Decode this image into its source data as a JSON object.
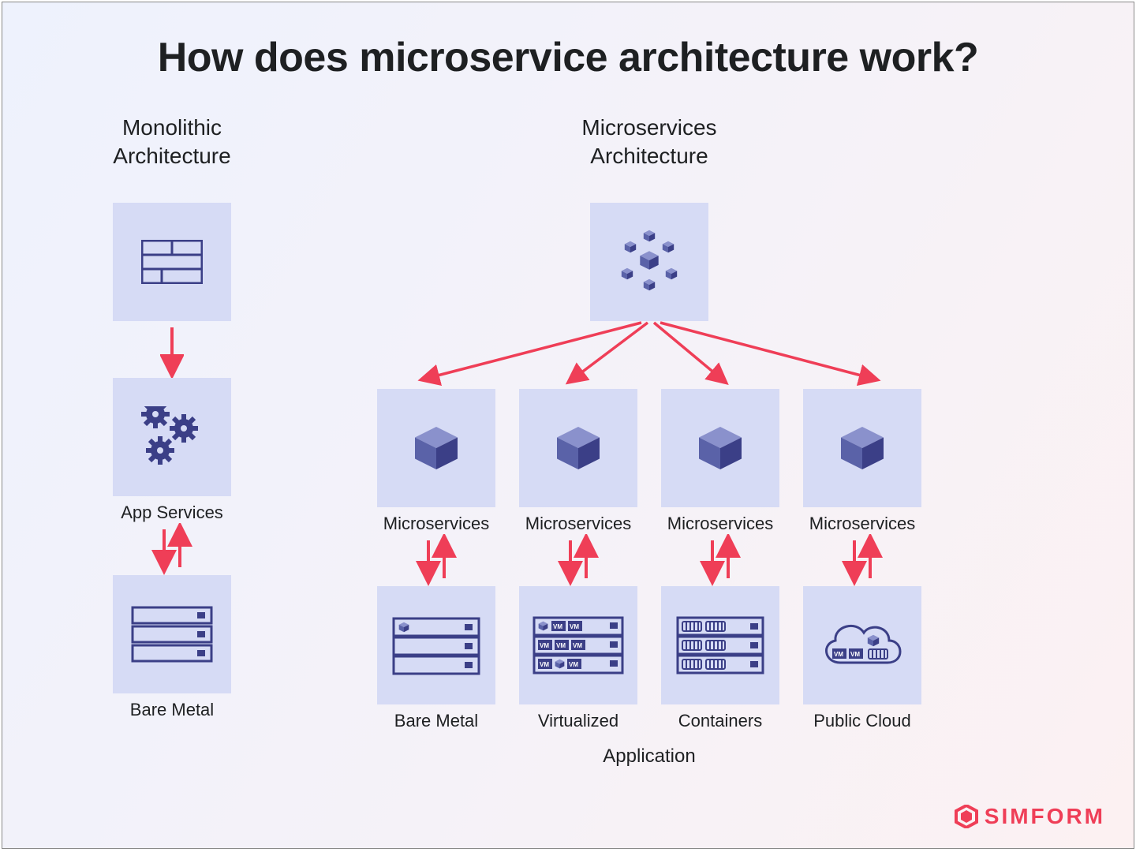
{
  "title": "How does microservice architecture work?",
  "monolithic": {
    "title": "Monolithic\nArchitecture",
    "app_services_label": "App Services",
    "bare_metal_label": "Bare Metal"
  },
  "microservices": {
    "title": "Microservices\nArchitecture",
    "node_label": "Microservices",
    "targets": [
      {
        "label": "Bare Metal"
      },
      {
        "label": "Virtualized"
      },
      {
        "label": "Containers"
      },
      {
        "label": "Public Cloud"
      }
    ],
    "row_label": "Application"
  },
  "brand": "SIMFORM",
  "colors": {
    "tile": "#d6dbf5",
    "icon_dark": "#3b3f87",
    "icon_mid": "#6b73b8",
    "arrow": "#ef3e57"
  }
}
